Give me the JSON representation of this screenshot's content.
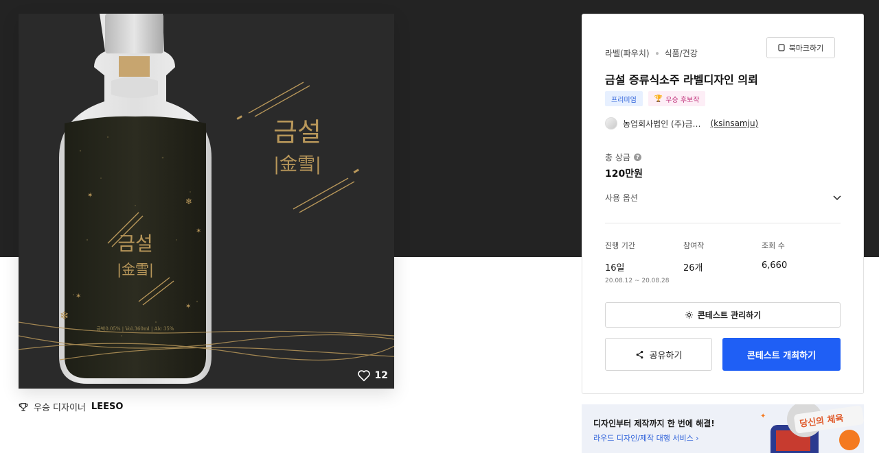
{
  "hero": {
    "label_title": "금설",
    "label_hanja": "|金雪|",
    "label_small_info": "금박0.05%  |  Vol.360ml  |  Alc 35%",
    "likes": "12"
  },
  "winner": {
    "prefix": "우승 디자이너",
    "name": "LEESO"
  },
  "card": {
    "category": "라벨(파우치)",
    "subcategory": "식품/건강",
    "bookmark_label": "북마크하기",
    "title": "금설 증류식소주 라벨디자인 의뢰",
    "badge_premium": "프리미엄",
    "badge_candidate": "우승 후보작",
    "host_name": "농업회사법인 (주)금…",
    "host_handle": "(ksinsamju)",
    "prize_label": "총 상금",
    "prize_value": "120만원",
    "usage_label": "사용 옵션",
    "stats": {
      "period_label": "진행 기간",
      "period_value": "16일",
      "period_range": "20.08.12  ~  20.08.28",
      "participants_label": "참여작",
      "participants_value": "26개",
      "views_label": "조회 수",
      "views_value": "6,660"
    },
    "manage_label": "콘테스트 관리하기",
    "share_label": "공유하기",
    "host_contest_label": "콘테스트 개최하기"
  },
  "banner": {
    "headline": "디자인부터 제작까지 한 번에 해결!",
    "link": "라우드 디자인/제작 대행 서비스 ›",
    "art_text": "당신의 체육"
  },
  "colors": {
    "primary": "#1f5ff5",
    "dark_band": "#232323",
    "gold": "#b8975a"
  }
}
